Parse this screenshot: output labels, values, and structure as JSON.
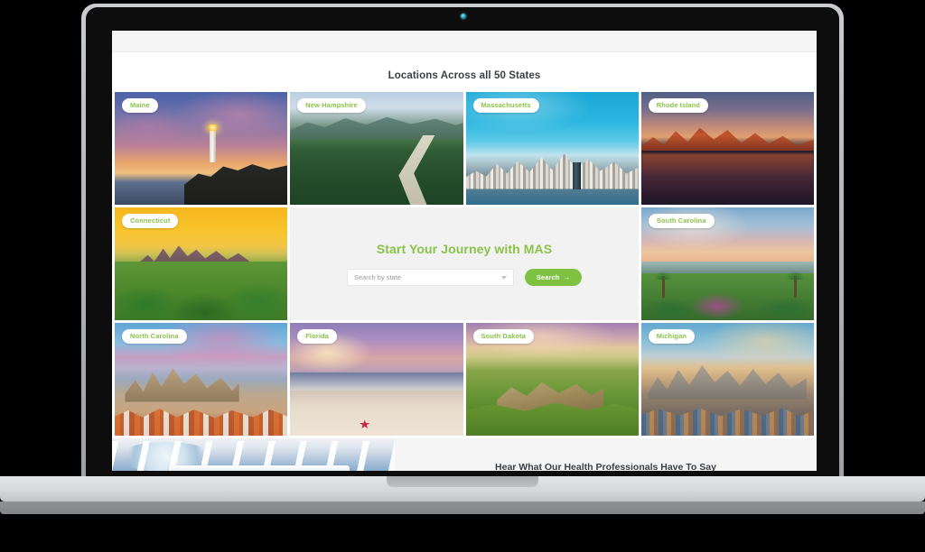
{
  "device": {
    "type": "laptop-mockup",
    "camera_icon": "camera-dot-icon"
  },
  "page": {
    "title": "Locations Across all 50 States"
  },
  "search_panel": {
    "heading": "Start Your Journey with MAS",
    "select": {
      "value": "Search by state",
      "caret_icon": "chevron-down-icon"
    },
    "button": {
      "label": "Search",
      "arrow_icon": "arrow-right-icon"
    }
  },
  "tiles": [
    {
      "state": "Maine",
      "art": "art-maine",
      "row": 1,
      "col": 1
    },
    {
      "state": "New Hampshire",
      "art": "art-nh",
      "row": 1,
      "col": 2
    },
    {
      "state": "Massachusetts",
      "art": "art-ma",
      "row": 1,
      "col": 3
    },
    {
      "state": "Rhode Island",
      "art": "art-ri",
      "row": 1,
      "col": 4
    },
    {
      "state": "Connecticut",
      "art": "art-ct",
      "row": 3,
      "col": 1
    },
    {
      "state": "South Carolina",
      "art": "art-sc",
      "row": 3,
      "col": 4
    },
    {
      "state": "North Carolina",
      "art": "art-nc",
      "row": 5,
      "col": 1
    },
    {
      "state": "Florida",
      "art": "art-fl",
      "row": 5,
      "col": 2
    },
    {
      "state": "South Dakota",
      "art": "art-sd",
      "row": 5,
      "col": 3
    },
    {
      "state": "Michigan",
      "art": "art-mi",
      "row": 5,
      "col": 4
    }
  ],
  "testimonials": {
    "heading": "Hear What Our Health Professionals Have To Say",
    "photo_alt": "clinic-operating-room-photo"
  },
  "colors": {
    "brand_green": "#8bc34a",
    "button_green": "#7fc241",
    "heading_dark": "#3b3f45",
    "panel_bg": "#f2f2f2"
  }
}
